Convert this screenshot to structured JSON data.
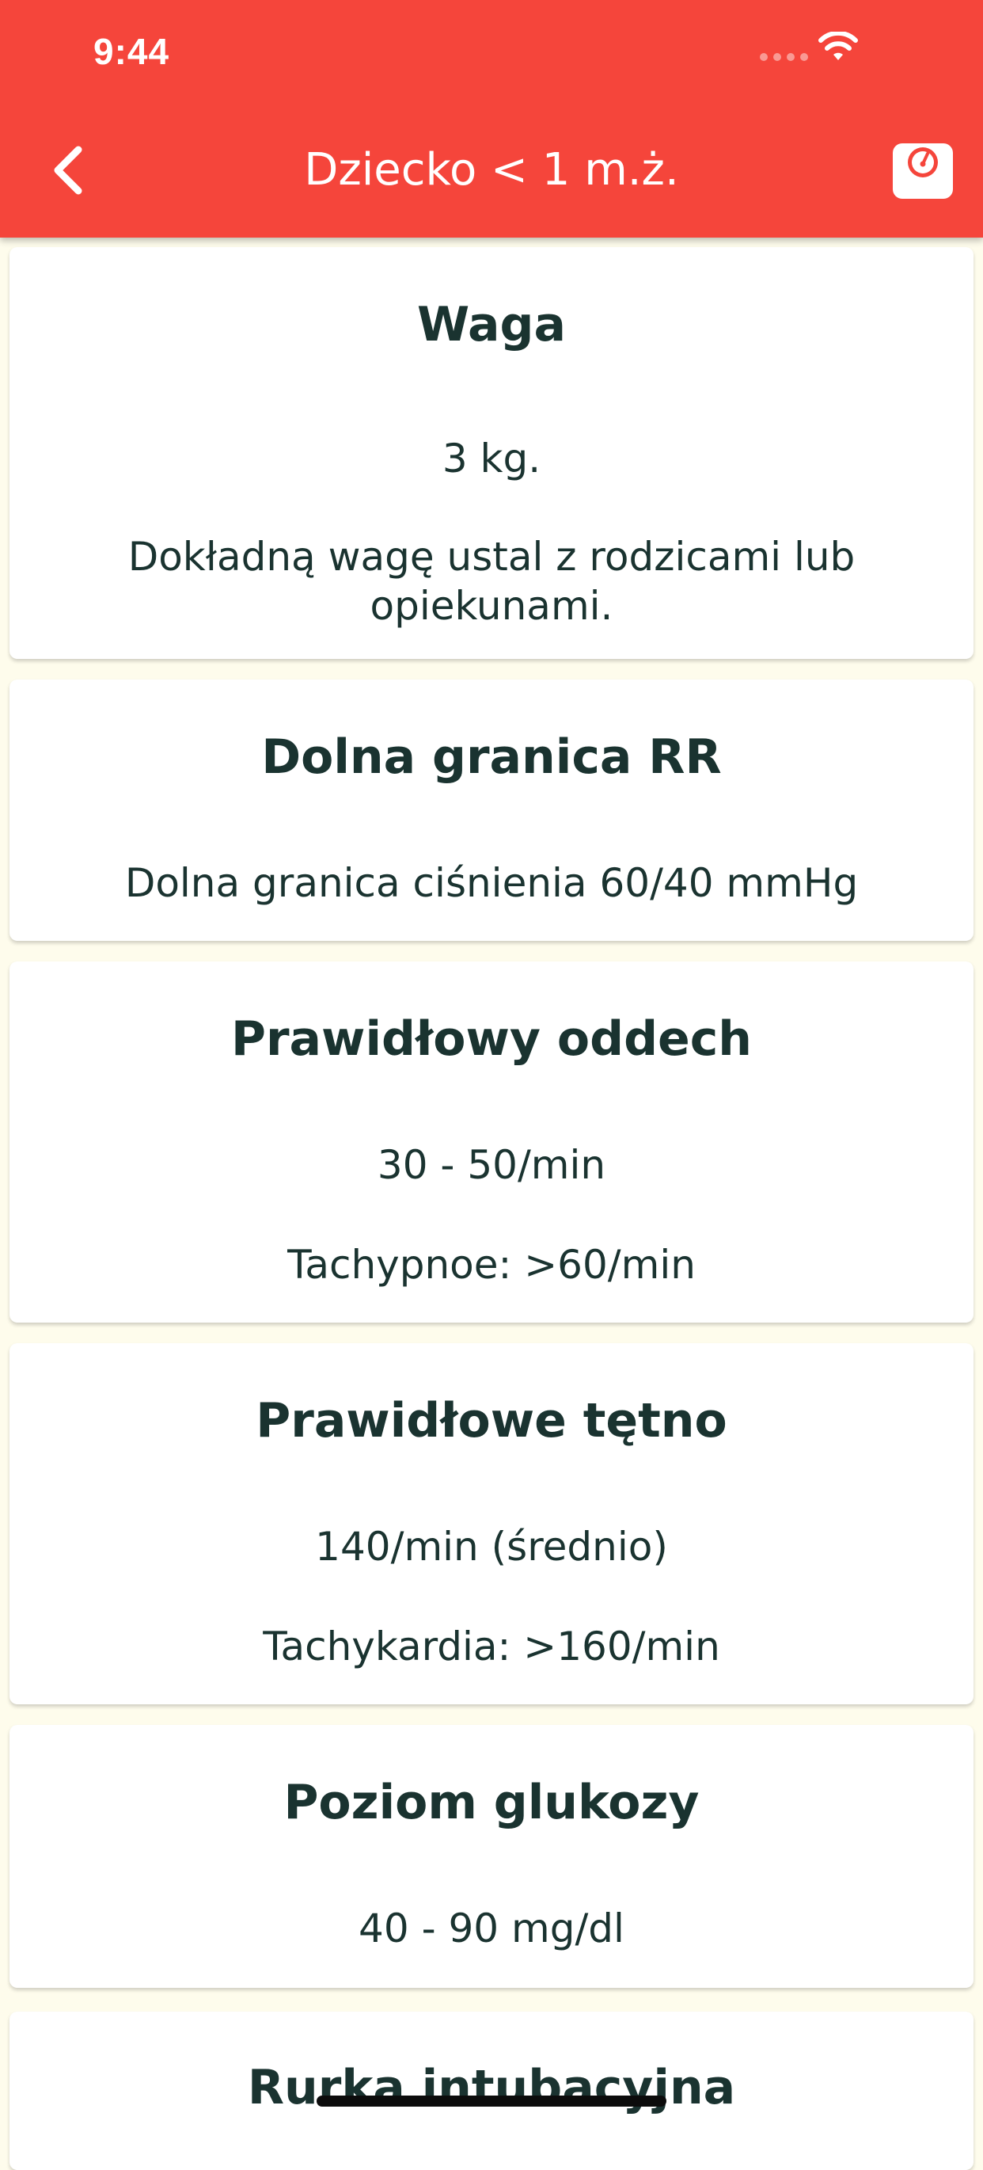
{
  "status_bar": {
    "time": "9:44"
  },
  "nav": {
    "title": "Dziecko < 1 m.ż.",
    "back_icon": "chevron-left-icon",
    "action_icon": "scale-icon"
  },
  "colors": {
    "header": "#F5453B",
    "background": "#FEFCEC",
    "card": "#FFFFFF",
    "text": "#1A3330"
  },
  "cards": [
    {
      "title": "Waga",
      "lines": [
        "3 kg.",
        "Dokładną wagę ustal z rodzicami lub opiekunami."
      ]
    },
    {
      "title": "Dolna granica RR",
      "lines": [
        "Dolna granica ciśnienia 60/40 mmHg"
      ]
    },
    {
      "title": "Prawidłowy oddech",
      "lines": [
        "30 - 50/min",
        "Tachypnoe: >60/min"
      ]
    },
    {
      "title": "Prawidłowe tętno",
      "lines": [
        "140/min (średnio)",
        "Tachykardia: >160/min"
      ]
    },
    {
      "title": "Poziom glukozy",
      "lines": [
        "40 - 90 mg/dl"
      ]
    },
    {
      "title": "Rurka intubacyjna",
      "lines": []
    }
  ]
}
